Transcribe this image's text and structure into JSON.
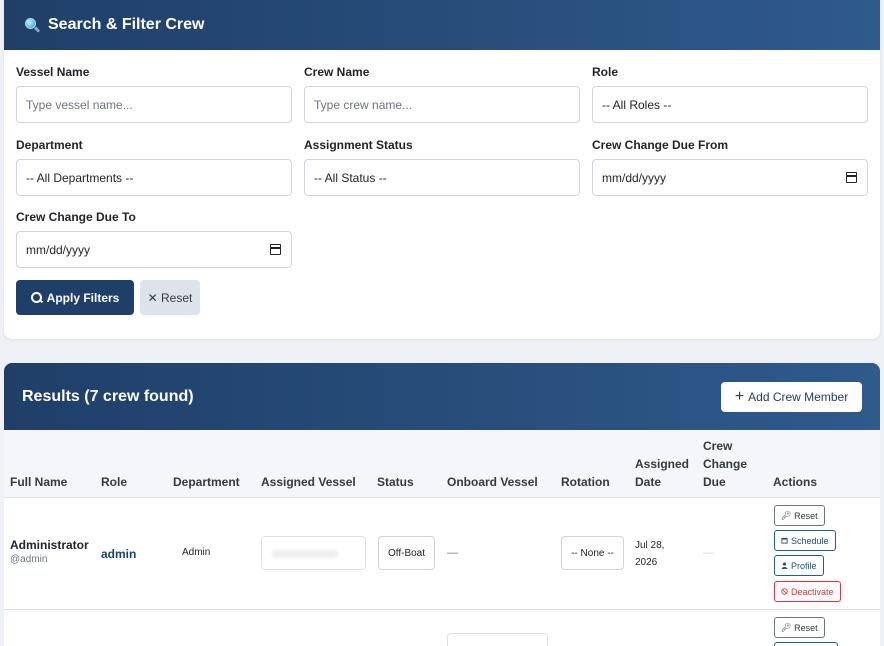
{
  "filter_panel": {
    "title": "Search & Filter Crew",
    "fields": {
      "vessel_name": {
        "label": "Vessel Name",
        "placeholder": "Type vessel name..."
      },
      "crew_name": {
        "label": "Crew Name",
        "placeholder": "Type crew name..."
      },
      "role": {
        "label": "Role",
        "value": "-- All Roles --"
      },
      "department": {
        "label": "Department",
        "value": "-- All Departments --"
      },
      "assignment_status": {
        "label": "Assignment Status",
        "value": "-- All Status --"
      },
      "crew_change_due_from": {
        "label": "Crew Change Due From",
        "value": "mm/dd/yyyy"
      },
      "crew_change_due_to": {
        "label": "Crew Change Due To",
        "value": "mm/dd/yyyy"
      }
    },
    "apply_label": "Apply Filters",
    "reset_label": "✕ Reset"
  },
  "results": {
    "title": "Results (7 crew found)",
    "add_label": "Add Crew Member",
    "columns": {
      "full_name": "Full Name",
      "role": "Role",
      "department": "Department",
      "assigned_vessel": "Assigned Vessel",
      "status": "Status",
      "onboard_vessel": "Onboard Vessel",
      "rotation": "Rotation",
      "assigned_date_1": "Assigned",
      "assigned_date_2": "Date",
      "crew_change_due_1": "Crew",
      "crew_change_due_2": "Change",
      "crew_change_due_3": "Due",
      "actions": "Actions"
    },
    "rows": [
      {
        "name": "Administrator",
        "username": "@admin",
        "role": "admin",
        "department": "Admin",
        "status": "Off-Boat",
        "onboard_vessel": "—",
        "rotation": "-- None --",
        "assigned_date_1": "Jul 28,",
        "assigned_date_2": "2026",
        "crew_change_due": "—",
        "actions": {
          "reset": "Reset",
          "schedule": "Schedule",
          "profile": "Profile",
          "deactivate": "Deactivate"
        }
      },
      {
        "actions": {
          "reset": "Reset"
        }
      }
    ]
  },
  "colors": {
    "header": "#1f3f68",
    "accent": "#2f5a8c",
    "danger": "#dc3545"
  }
}
